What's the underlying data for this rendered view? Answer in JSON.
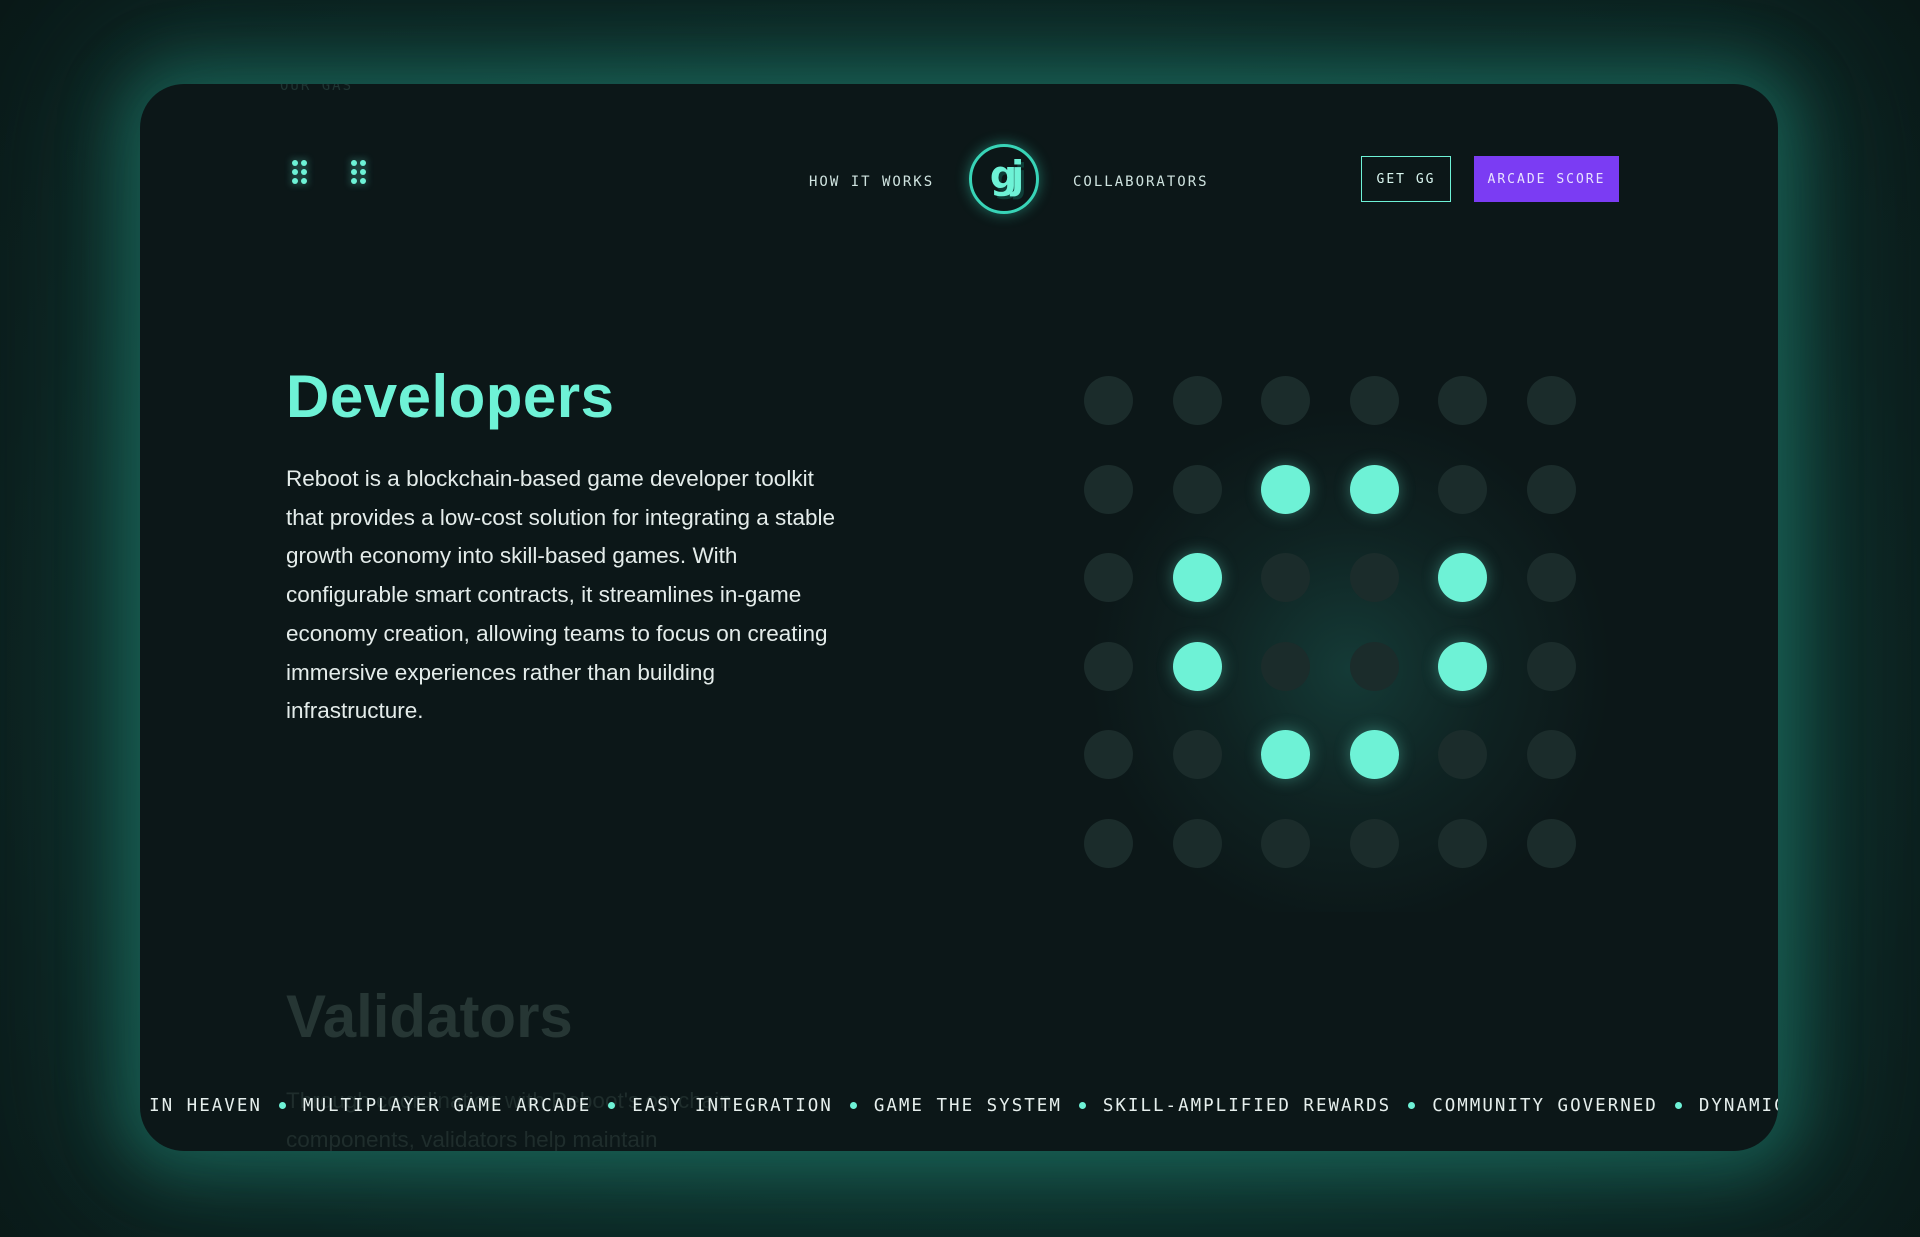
{
  "nav": {
    "how_it_works": "HOW IT WORKS",
    "collaborators": "COLLABORATORS",
    "get_gg": "GET GG",
    "arcade_score": "ARCADE SCORE",
    "logo_glyph": "gj",
    "ghost_text": "OUR GAS"
  },
  "sections": {
    "developers": {
      "title": "Developers",
      "description": "Reboot is a blockchain-based game developer toolkit that provides a low-cost solution for integrating a stable growth economy into skill-based games. With configurable smart contracts, it streamlines in-game economy creation, allowing teams to focus on creating immersive experiences rather than building infrastructure."
    },
    "validators": {
      "title": "Validators",
      "description": "Through coordination with Reboot's on-chain components, validators help maintain"
    }
  },
  "grid": {
    "rows": [
      [
        0,
        0,
        0,
        0,
        0,
        0
      ],
      [
        0,
        0,
        1,
        1,
        0,
        0
      ],
      [
        0,
        1,
        0,
        0,
        1,
        0
      ],
      [
        0,
        1,
        0,
        0,
        1,
        0
      ],
      [
        0,
        0,
        1,
        1,
        0,
        0
      ],
      [
        0,
        0,
        0,
        0,
        0,
        0
      ]
    ],
    "on_color": "#6ef2d6",
    "off_color": "#1b2c2b"
  },
  "marquee": [
    "E IN HEAVEN",
    "MULTIPLAYER GAME ARCADE",
    "EASY INTEGRATION",
    "GAME THE SYSTEM",
    "SKILL-AMPLIFIED REWARDS",
    "COMMUNITY GOVERNED",
    "DYNAMICALLY"
  ],
  "colors": {
    "accent": "#6ef2d6",
    "primary_button": "#7b3cf3",
    "panel": "#0c1718"
  }
}
